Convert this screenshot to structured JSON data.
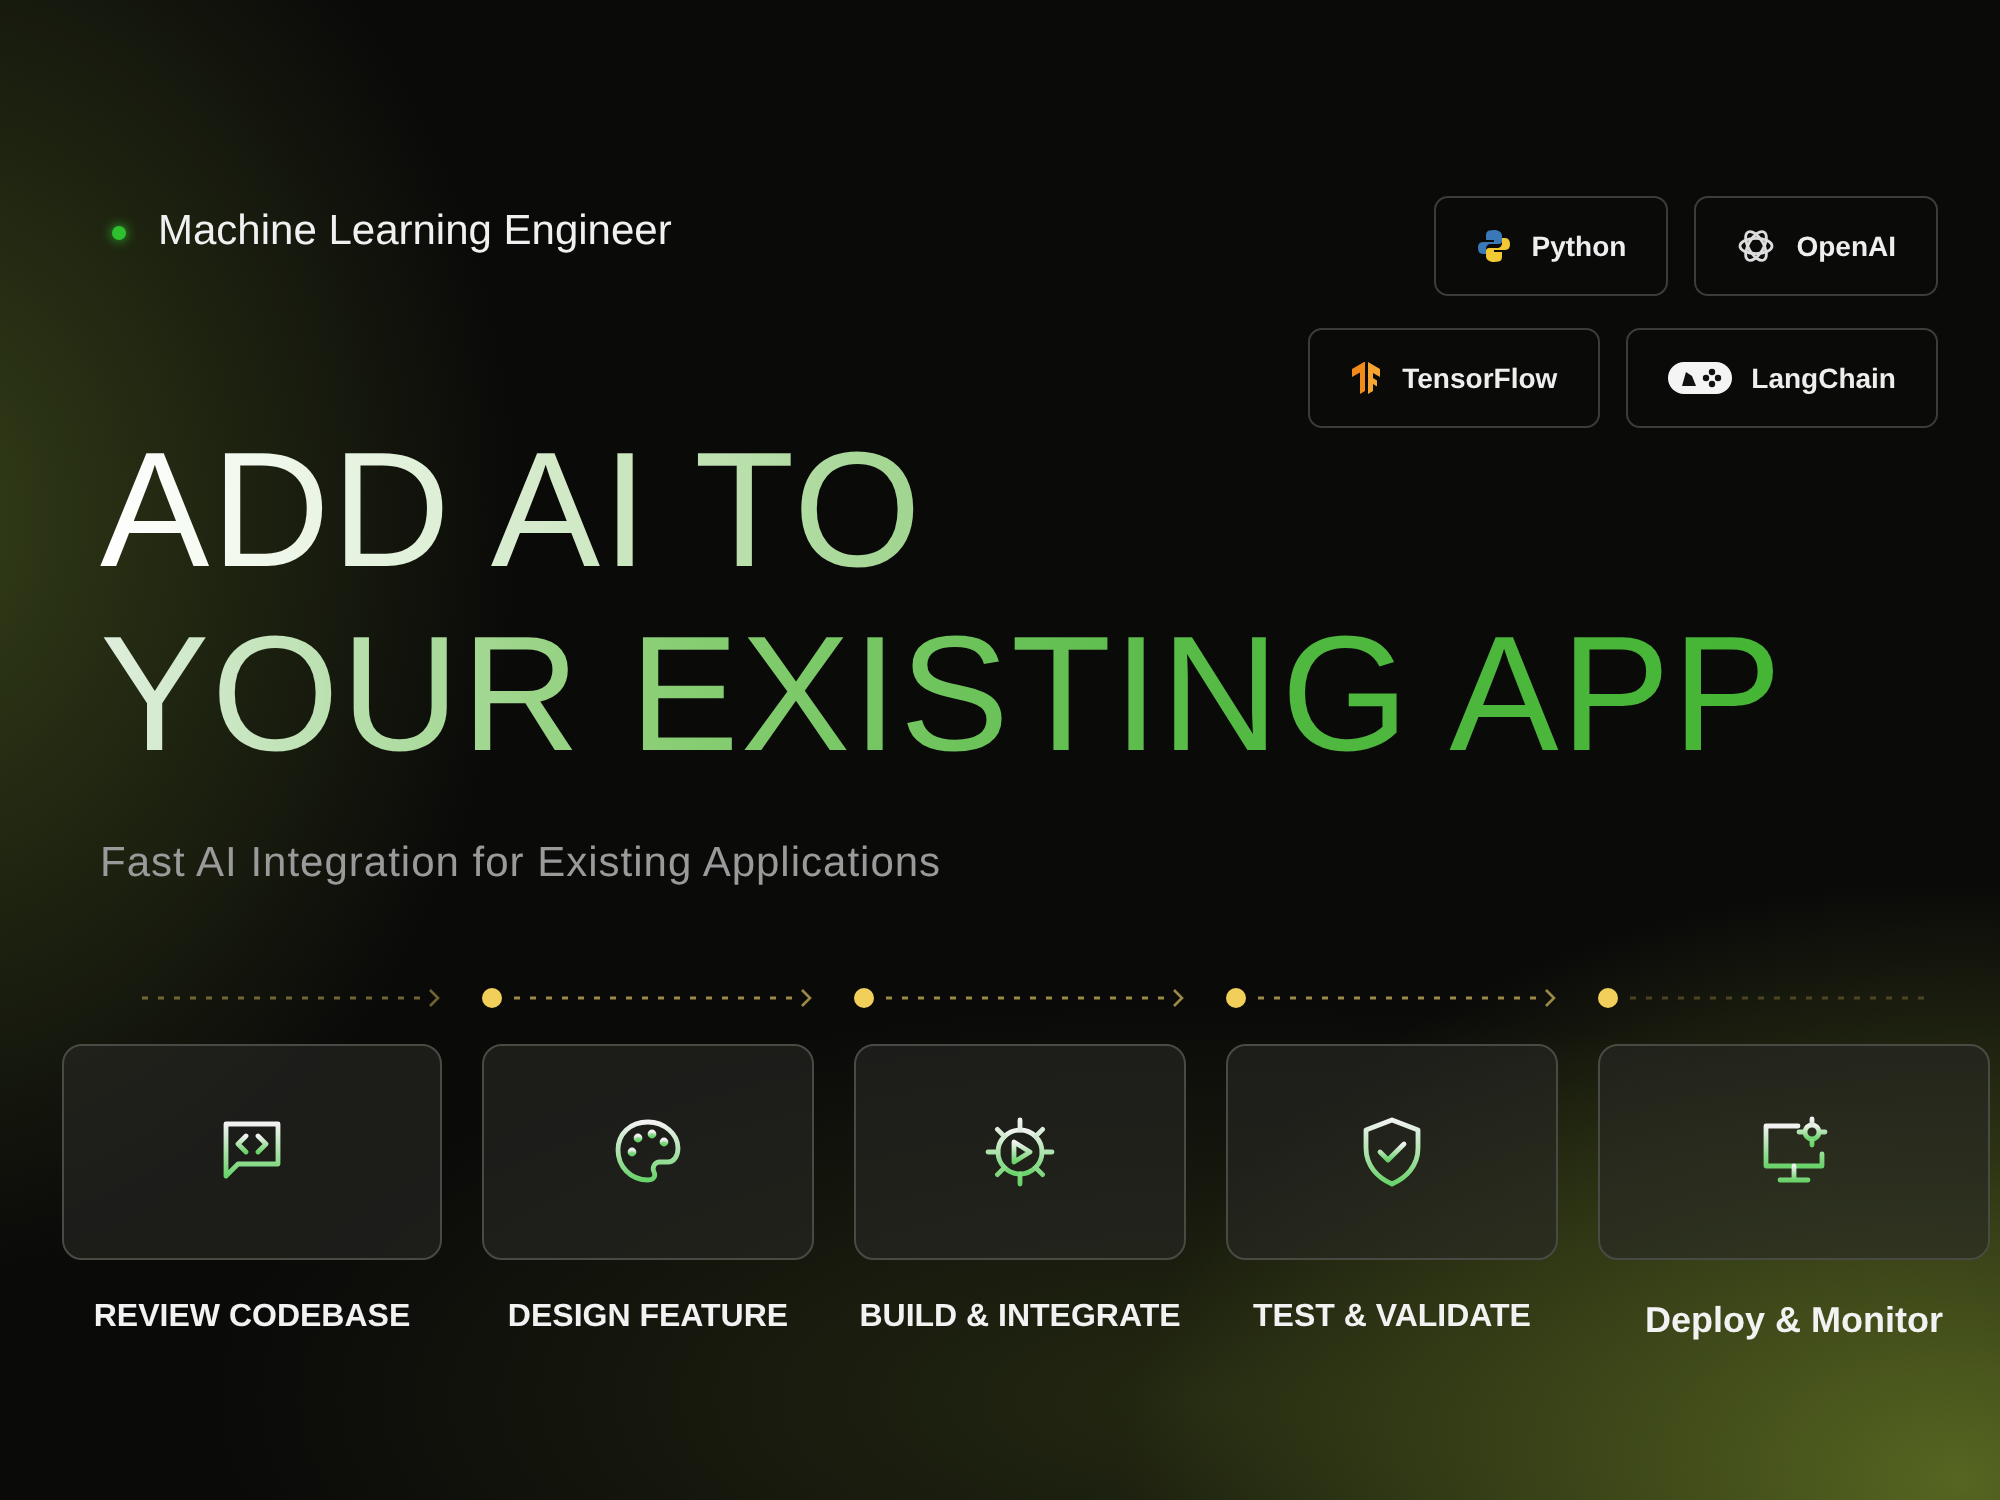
{
  "role": {
    "label": "Machine Learning Engineer"
  },
  "tags": [
    {
      "label": "Python",
      "kind": "python"
    },
    {
      "label": "OpenAI",
      "kind": "openai"
    },
    {
      "label": "TensorFlow",
      "kind": "tensorflow"
    },
    {
      "label": "LangChain",
      "kind": "langchain"
    }
  ],
  "headline": [
    "ADD AI TO",
    "YOUR EXISTING APP"
  ],
  "subtitle": "Fast AI Integration for Existing Applications",
  "steps": [
    {
      "label": "REVIEW CODEBASE",
      "kind": "code"
    },
    {
      "label": "DESIGN FEATURE",
      "kind": "palette"
    },
    {
      "label": "BUILD & INTEGRATE",
      "kind": "gear"
    },
    {
      "label": "TEST & VALIDATE",
      "kind": "shield"
    },
    {
      "label": "Deploy & Monitor",
      "kind": "monitor"
    }
  ]
}
